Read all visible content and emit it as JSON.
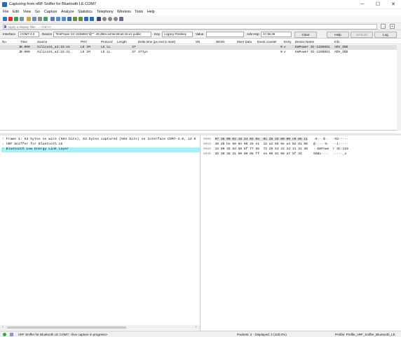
{
  "window": {
    "title": "Capturing from nRF Sniffer for Bluetooth LE COM7",
    "minimize": "─",
    "maximize": "☐",
    "close": "✕"
  },
  "menu": [
    "File",
    "Edit",
    "View",
    "Go",
    "Capture",
    "Analyze",
    "Statistics",
    "Telephony",
    "Wireless",
    "Tools",
    "Help"
  ],
  "filter": {
    "placeholder": "Apply a display filter … <Ctrl-/>",
    "arrow": "→",
    "plus": "+"
  },
  "sniffer": {
    "interface_label": "Interface",
    "interface_value": "COM7-4.0",
    "device_label": "Device",
    "device_value": "\"EmPower SC-1105081\"@\"\"  -46 dBm  a4:9e:69:a2:15:e1  public",
    "key_label": "Key",
    "key_value": "Legacy Passkey",
    "value_label": "Value",
    "value_value": "",
    "advhop_label": "Adv Hop",
    "advhop_value": "37,38,39",
    "clear": "Clear",
    "help": "Help",
    "defaults": "Defaults",
    "log": "Log"
  },
  "packet_list": {
    "columns": [
      "No.",
      "Time",
      "Source",
      "PHY",
      "Protocol",
      "Length",
      "Delta time (µs end to start)",
      "SN",
      "NESN",
      "More Data",
      "Event counter",
      "Entry",
      "Device Name",
      "Info"
    ],
    "rows": [
      {
        "no": "1",
        "time": "0.000",
        "source": "Silicon1_a2:15:e1",
        "phy": "LE 1M",
        "protocol": "LE LL",
        "length": "37",
        "delta": "",
        "sn": "",
        "nesn": "",
        "more": "",
        "event": "0",
        "entry": "✔",
        "device": "EmPower SC-1105081",
        "info": "ADV_IND"
      },
      {
        "no": "2",
        "time": "0.000",
        "source": "Silicon1_a2:15:e1",
        "phy": "LE 1M",
        "protocol": "LE LL",
        "length": "37",
        "delta": "377µs",
        "sn": "",
        "nesn": "",
        "more": "",
        "event": "0",
        "entry": "✔",
        "device": "EmPower SC-1105081",
        "info": "ADV_IND"
      }
    ]
  },
  "details": [
    "Frame 1: 63 bytes on wire (504 bits), 63 bytes captured (504 bits) on interface COM7-4.0, id 0",
    "nRF Sniffer for Bluetooth LE",
    "Bluetooth Low Energy Link Layer"
  ],
  "hex": [
    {
      "offset": "0000",
      "bytes": "07 38 00 03 18 24 02 0a  01 25 33 00 00 c0 85 11",
      "ascii": "·8···$··  ·%3·····"
    },
    {
      "offset": "0010",
      "bytes": "40 d6 be 89 8e 00 25 e1  15 a2 69 9e a4 02 01 06",
      "ascii": "@·····%·  ··i·····"
    },
    {
      "offset": "0020",
      "bytes": "15 09 45 6d 50 6f 77 65  72 20 53 43 2d 31 31 30",
      "ascii": "··EmPowe  r SC-110"
    },
    {
      "offset": "0030",
      "bytes": "35 30 38 31 00 00 05 ff  ea 00 01 00 a7 5f 34",
      "ascii": "5081····  ·····_4"
    }
  ],
  "status": {
    "capture": "nRF Sniffer for Bluetooth LE COM7: <live capture in progress>",
    "packets": "Packets: 2 · Displayed: 2 (100.0%)",
    "profile": "Profile: Profile_nRF_Sniffer_Bluetooth_LE"
  },
  "colors": {
    "selected_row": "#e0e0e0",
    "highlight_row": "#a8f0f8",
    "accent": "#1f6fbf"
  }
}
